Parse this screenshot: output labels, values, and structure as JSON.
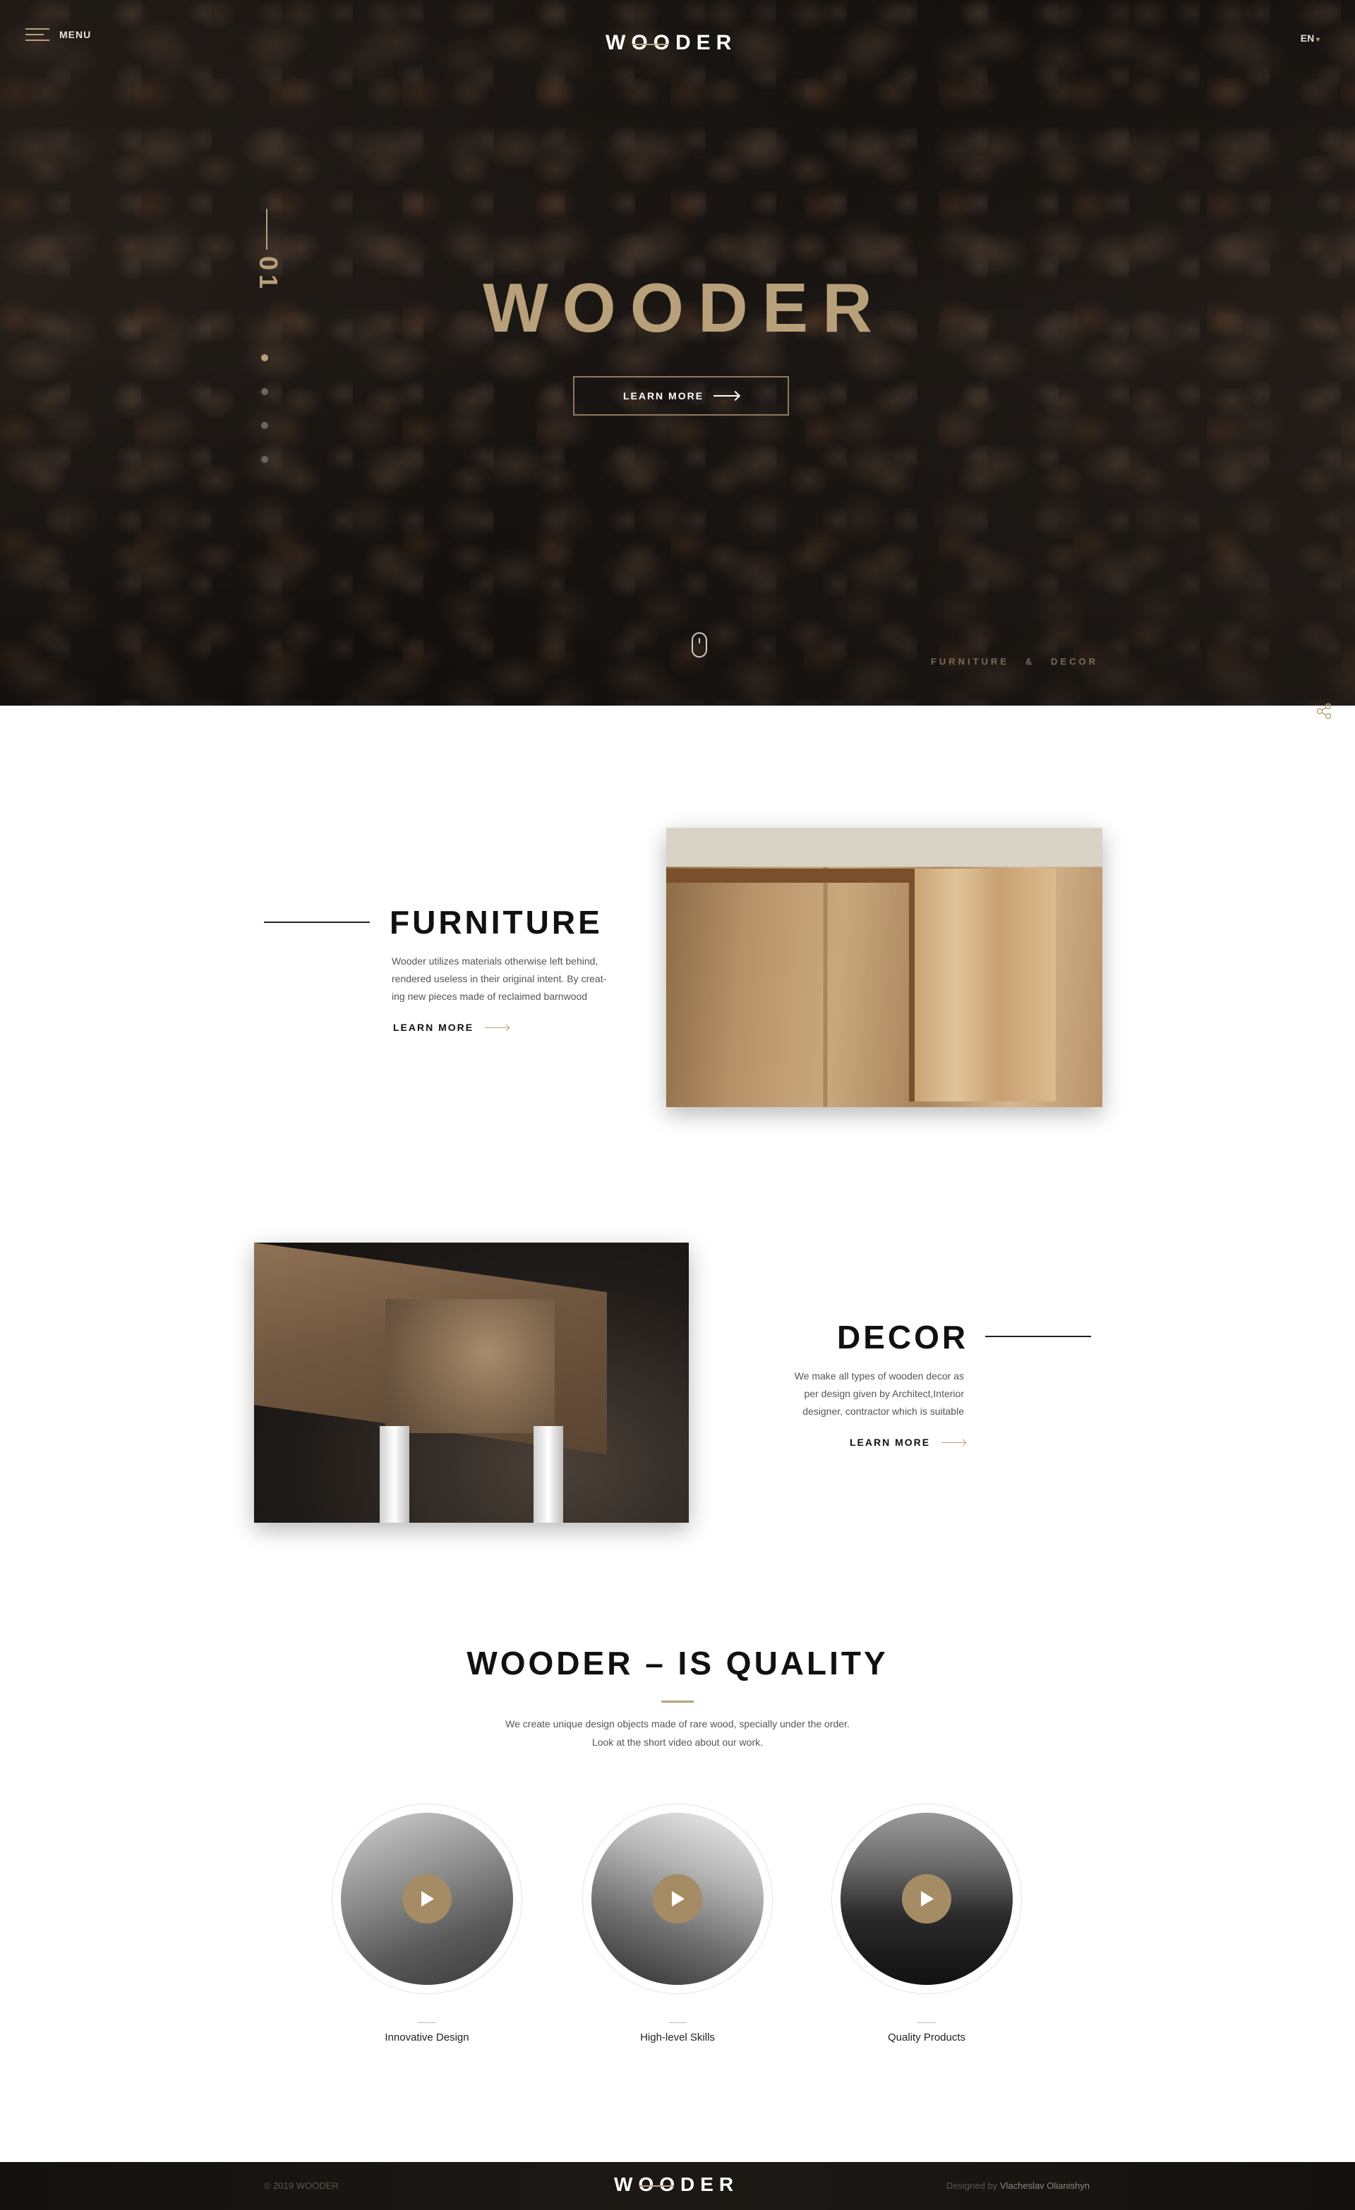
{
  "header": {
    "menu_label": "MENU",
    "brand": {
      "pre": "W",
      "oo": "OO",
      "post": "DER"
    },
    "language": "EN"
  },
  "hero": {
    "slide_number": "01",
    "title": "WOODER",
    "cta_label": "LEARN MORE",
    "tagline": "FURNITURE   &   DECOR",
    "slides_count": 4,
    "active_slide": 1
  },
  "furniture": {
    "title": "FURNITURE",
    "text_lines": [
      "Wooder utilizes materials otherwise left behind,",
      "rendered useless in their original intent. By creat-",
      "ing new pieces made of reclaimed barnwood"
    ],
    "link_label": "LEARN MORE"
  },
  "decor": {
    "title": "DECOR",
    "text_lines": [
      "We make all types of wooden decor as",
      "per design given by Architect,Interior",
      "designer, contractor which is suitable"
    ],
    "link_label": "LEARN MORE"
  },
  "quality": {
    "title": "WOODER – IS QUALITY",
    "text_lines": [
      "We create unique design objects made of rare wood, specially under the order.",
      "Look at the short video about our work."
    ],
    "features": [
      {
        "label": "Innovative Design"
      },
      {
        "label": "High-level Skills"
      },
      {
        "label": "Quality Products"
      }
    ]
  },
  "footer": {
    "copyright": "© 2019 WOODER",
    "credit_prefix": "Designed by",
    "credit_name": "Vlacheslav Olianishyn"
  },
  "colors": {
    "accent": "#b8a07a",
    "play_button": "#a68c64",
    "dark": "#111111"
  },
  "icons": {
    "menu": "hamburger-icon",
    "language": "caret-down-icon",
    "scroll": "mouse-icon",
    "share": "share-icon",
    "play": "play-icon",
    "arrow": "arrow-right-icon"
  }
}
